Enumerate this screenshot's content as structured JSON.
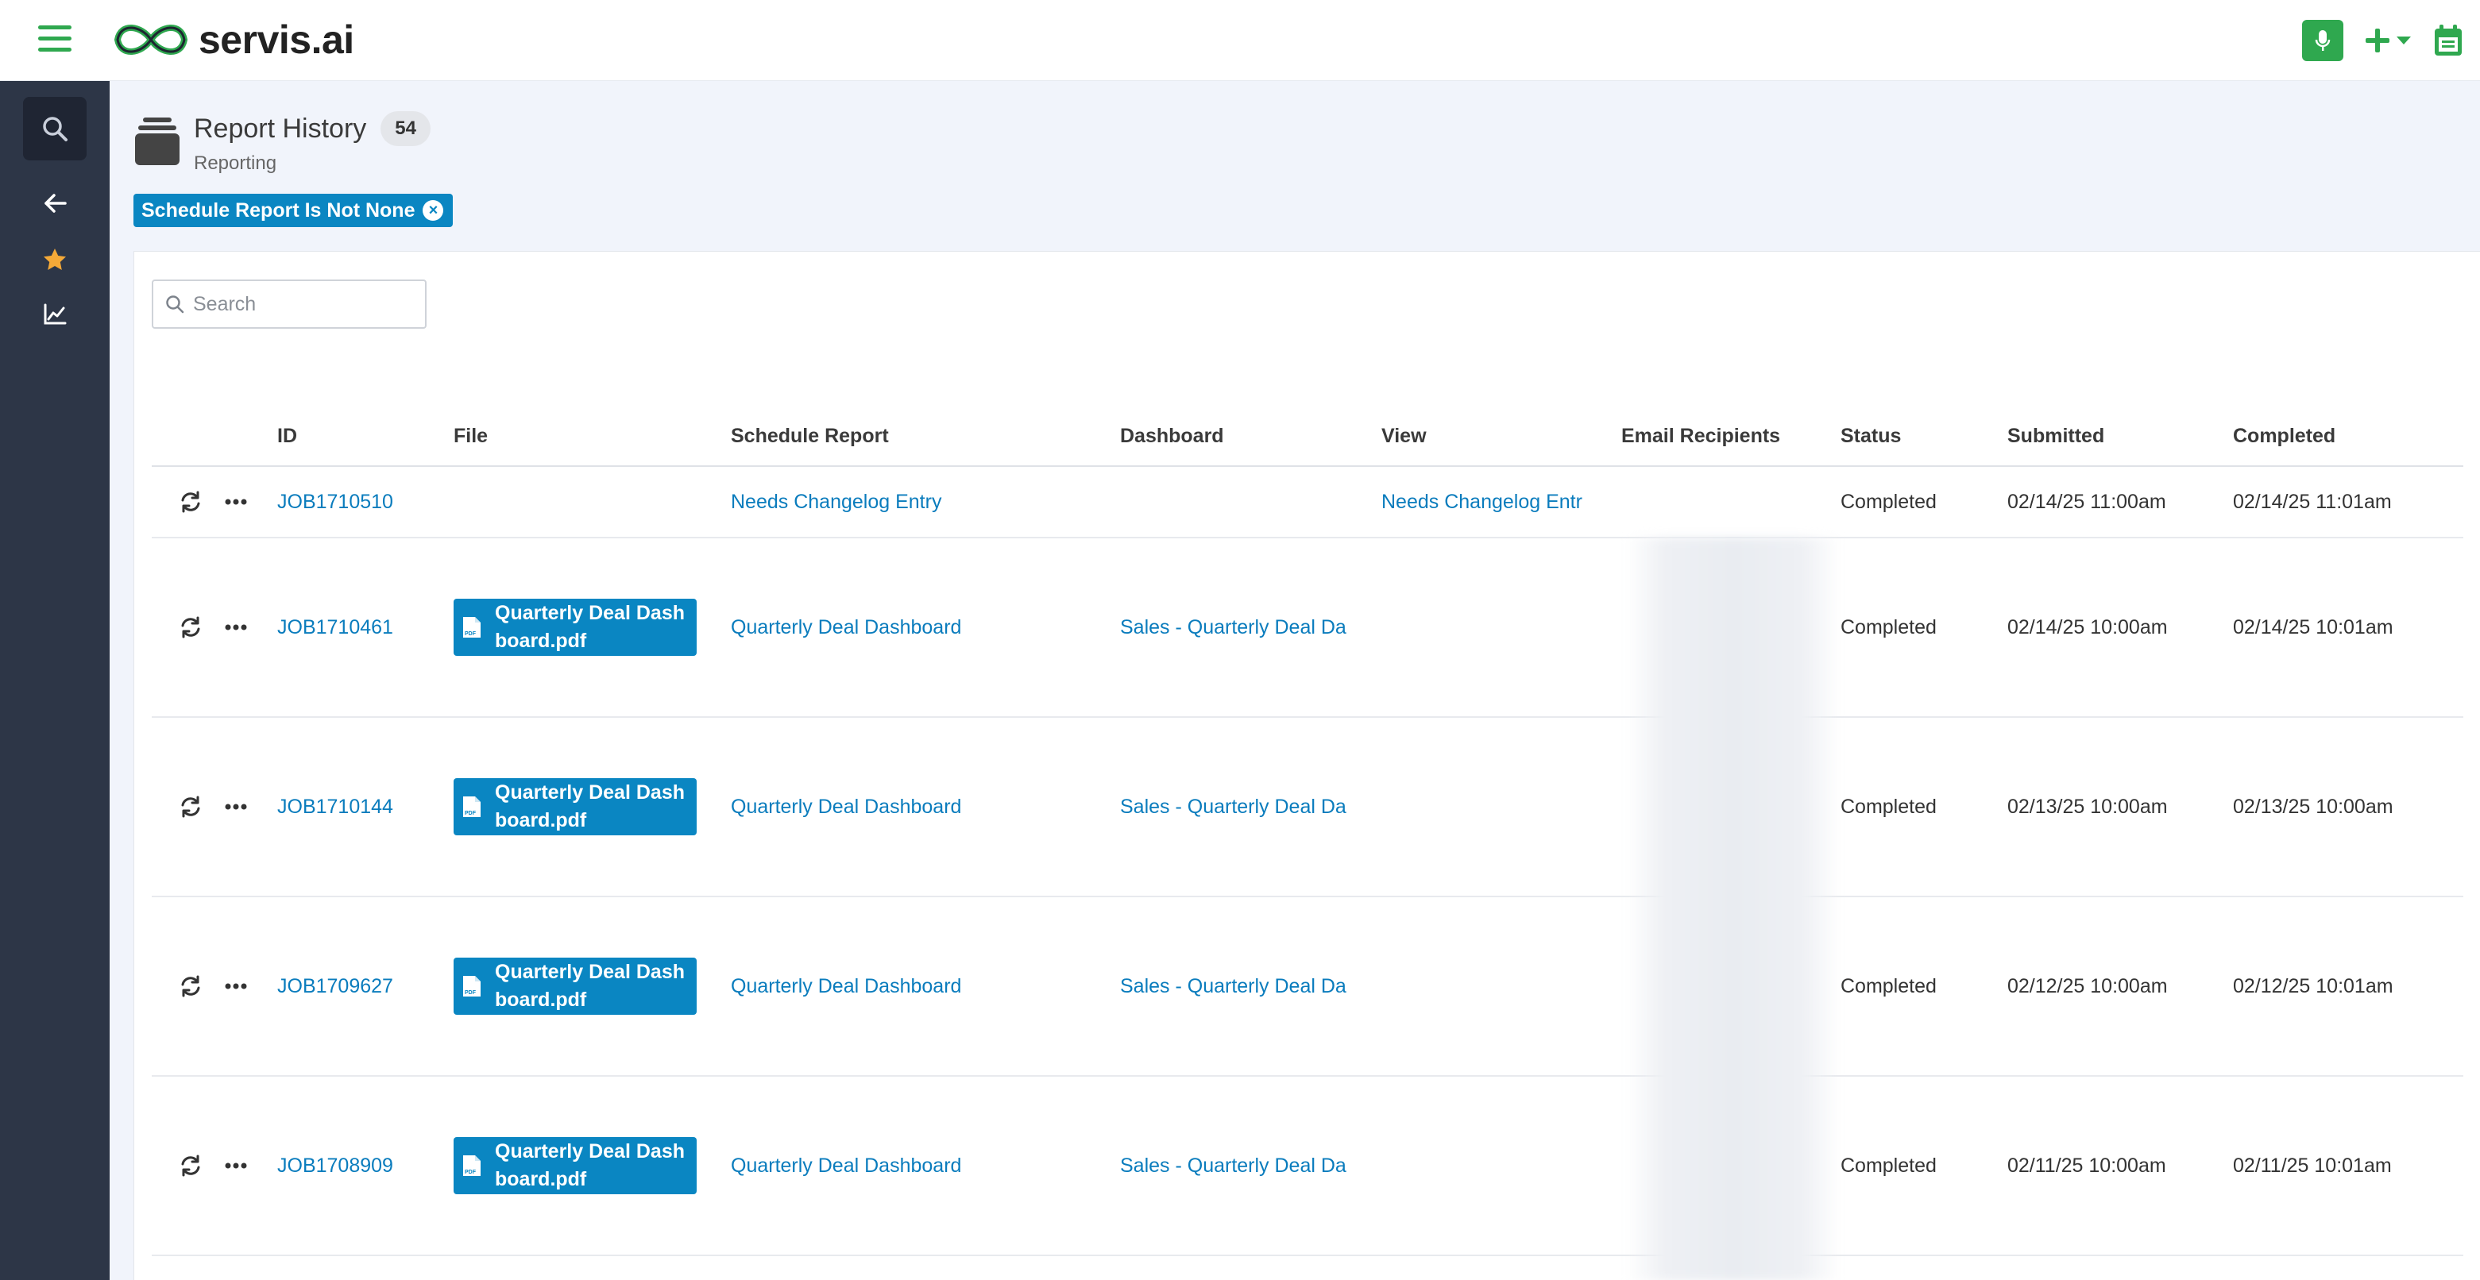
{
  "brand": {
    "name": "servis.ai",
    "accent": "#2fa84f",
    "link_color": "#0a7cbd",
    "button_color": "#0a86c2"
  },
  "header": {
    "title": "Report History",
    "count": "54",
    "subtitle": "Reporting"
  },
  "filter": {
    "label": "Schedule Report Is Not None",
    "remove_icon": "close-circle-icon"
  },
  "search": {
    "placeholder": "Search",
    "value": ""
  },
  "sidebar": {
    "items": [
      {
        "icon": "search-icon"
      },
      {
        "icon": "arrow-left-icon"
      },
      {
        "icon": "star-icon"
      },
      {
        "icon": "line-chart-icon"
      }
    ]
  },
  "table": {
    "columns": [
      "ID",
      "File",
      "Schedule Report",
      "Dashboard",
      "View",
      "Email Recipients",
      "Status",
      "Submitted",
      "Completed"
    ],
    "rows": [
      {
        "id": "JOB1710510",
        "file": "",
        "schedule_report": "Needs Changelog Entry",
        "dashboard": "",
        "view": "Needs Changelog Entr",
        "email_recipients": "",
        "status": "Completed",
        "submitted": "02/14/25 11:00am",
        "completed": "02/14/25 11:01am"
      },
      {
        "id": "JOB1710461",
        "file": "Quarterly Deal Dashboard.pdf",
        "schedule_report": "Quarterly Deal Dashboard",
        "dashboard": "Sales - Quarterly Deal Da",
        "view": "",
        "email_recipients": "",
        "status": "Completed",
        "submitted": "02/14/25 10:00am",
        "completed": "02/14/25 10:01am"
      },
      {
        "id": "JOB1710144",
        "file": "Quarterly Deal Dashboard.pdf",
        "schedule_report": "Quarterly Deal Dashboard",
        "dashboard": "Sales - Quarterly Deal Da",
        "view": "",
        "email_recipients": "",
        "status": "Completed",
        "submitted": "02/13/25 10:00am",
        "completed": "02/13/25 10:00am"
      },
      {
        "id": "JOB1709627",
        "file": "Quarterly Deal Dashboard.pdf",
        "schedule_report": "Quarterly Deal Dashboard",
        "dashboard": "Sales - Quarterly Deal Da",
        "view": "",
        "email_recipients": "",
        "status": "Completed",
        "submitted": "02/12/25 10:00am",
        "completed": "02/12/25 10:01am"
      },
      {
        "id": "JOB1708909",
        "file": "Quarterly Deal Dashboard.pdf",
        "schedule_report": "Quarterly Deal Dashboard",
        "dashboard": "Sales - Quarterly Deal Da",
        "view": "",
        "email_recipients": "",
        "status": "Completed",
        "submitted": "02/11/25 10:00am",
        "completed": "02/11/25 10:01am"
      }
    ]
  }
}
